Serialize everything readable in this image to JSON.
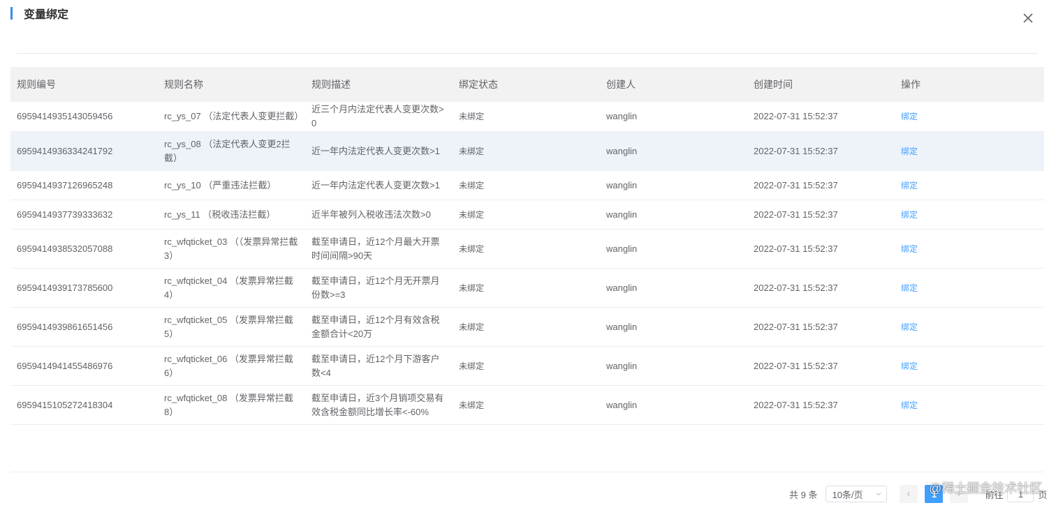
{
  "dialog": {
    "title": "变量绑定",
    "accent_color": "#3a8ee6",
    "close_icon": "close-icon"
  },
  "table": {
    "headers": [
      "规则编号",
      "规则名称",
      "规则描述",
      "绑定状态",
      "创建人",
      "创建时间",
      "操作"
    ],
    "rows": [
      {
        "id": "6959414935143059456",
        "name": "rc_ys_07 （法定代表人变更拦截）",
        "desc": "近三个月内法定代表人变更次数>0",
        "status": "未绑定",
        "creator": "wanglin",
        "created": "2022-07-31 15:52:37",
        "action": "绑定"
      },
      {
        "id": "6959414936334241792",
        "name": "rc_ys_08 （法定代表人变更2拦截）",
        "desc": "近一年内法定代表人变更次数>1",
        "status": "未绑定",
        "creator": "wanglin",
        "created": "2022-07-31 15:52:37",
        "action": "绑定"
      },
      {
        "id": "6959414937126965248",
        "name": "rc_ys_10 （严重违法拦截）",
        "desc": "近一年内法定代表人变更次数>1",
        "status": "未绑定",
        "creator": "wanglin",
        "created": "2022-07-31 15:52:37",
        "action": "绑定"
      },
      {
        "id": "6959414937739333632",
        "name": "rc_ys_11 （税收违法拦截）",
        "desc": "近半年被列入税收违法次数>0",
        "status": "未绑定",
        "creator": "wanglin",
        "created": "2022-07-31 15:52:37",
        "action": "绑定"
      },
      {
        "id": "6959414938532057088",
        "name": "rc_wfqticket_03 （（发票异常拦截3）",
        "desc": "截至申请日，近12个月最大开票时间间隔>90天",
        "status": "未绑定",
        "creator": "wanglin",
        "created": "2022-07-31 15:52:37",
        "action": "绑定"
      },
      {
        "id": "6959414939173785600",
        "name": "rc_wfqticket_04 （发票异常拦截4）",
        "desc": "截至申请日，近12个月无开票月份数>=3",
        "status": "未绑定",
        "creator": "wanglin",
        "created": "2022-07-31 15:52:37",
        "action": "绑定"
      },
      {
        "id": "6959414939861651456",
        "name": "rc_wfqticket_05 （发票异常拦截5）",
        "desc": "截至申请日，近12个月有效含税金额合计<20万",
        "status": "未绑定",
        "creator": "wanglin",
        "created": "2022-07-31 15:52:37",
        "action": "绑定"
      },
      {
        "id": "6959414941455486976",
        "name": "rc_wfqticket_06 （发票异常拦截6）",
        "desc": "截至申请日，近12个月下游客户数<4",
        "status": "未绑定",
        "creator": "wanglin",
        "created": "2022-07-31 15:52:37",
        "action": "绑定"
      },
      {
        "id": "6959415105272418304",
        "name": "rc_wfqticket_08 （发票异常拦截8）",
        "desc": "截至申请日，近3个月销项交易有效含税金额同比增长率<-60%",
        "status": "未绑定",
        "creator": "wanglin",
        "created": "2022-07-31 15:52:37",
        "action": "绑定"
      }
    ],
    "hovered_row": 1,
    "link_color": "#409eff"
  },
  "pagination": {
    "total": "共 9 条",
    "page_size": "10条/页",
    "prev_icon": "chevron-left-icon",
    "current_page": "1",
    "next_icon": "chevron-right-icon",
    "goto_label": "前往",
    "goto_value": "1",
    "goto_suffix": "页",
    "active_color": "#409eff"
  },
  "watermark": {
    "text": "@稀土掘金技术社区"
  }
}
